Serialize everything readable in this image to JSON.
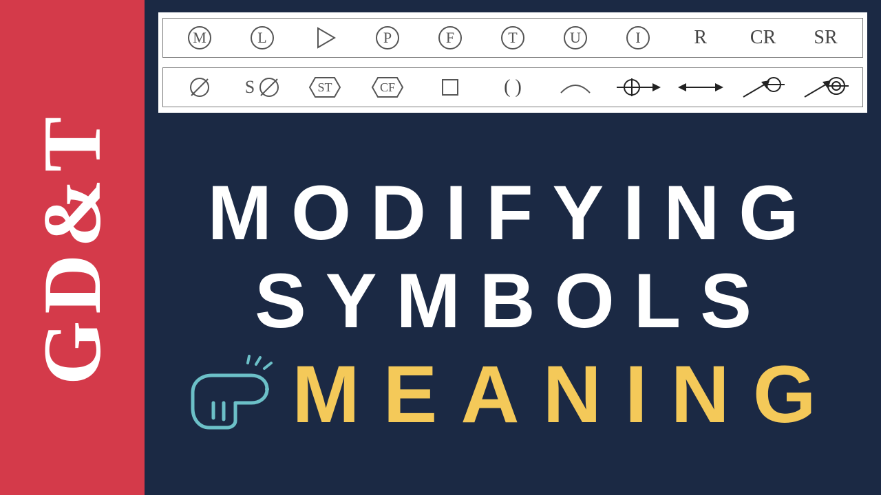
{
  "sidebar": {
    "label": "GD&T"
  },
  "symbols": {
    "row1": [
      {
        "name": "circled-m",
        "type": "circled",
        "char": "M"
      },
      {
        "name": "circled-l",
        "type": "circled",
        "char": "L"
      },
      {
        "name": "triangle-right",
        "type": "triangle"
      },
      {
        "name": "circled-p",
        "type": "circled",
        "char": "P"
      },
      {
        "name": "circled-f",
        "type": "circled",
        "char": "F"
      },
      {
        "name": "circled-t",
        "type": "circled",
        "char": "T"
      },
      {
        "name": "circled-u",
        "type": "circled",
        "char": "U"
      },
      {
        "name": "circled-i",
        "type": "circled",
        "char": "I"
      },
      {
        "name": "letter-r",
        "type": "text",
        "char": "R"
      },
      {
        "name": "letters-cr",
        "type": "text",
        "char": "CR"
      },
      {
        "name": "letters-sr",
        "type": "text",
        "char": "SR"
      }
    ],
    "row2": [
      {
        "name": "diameter",
        "type": "diameter"
      },
      {
        "name": "spherical-diameter",
        "type": "sdiameter",
        "char": "S"
      },
      {
        "name": "hex-st",
        "type": "hex",
        "char": "ST"
      },
      {
        "name": "hex-cf",
        "type": "hex",
        "char": "CF"
      },
      {
        "name": "square",
        "type": "square"
      },
      {
        "name": "parentheses",
        "type": "text",
        "char": "( )"
      },
      {
        "name": "arc",
        "type": "arc"
      },
      {
        "name": "circle-arrow-right",
        "type": "carrow"
      },
      {
        "name": "double-arrow",
        "type": "darrow"
      },
      {
        "name": "leader-circle",
        "type": "leader1"
      },
      {
        "name": "leader-concentric",
        "type": "leader2"
      }
    ]
  },
  "headline": {
    "line1": "MODIFYING",
    "line2": "SYMBOLS",
    "line3": "MEANING"
  }
}
